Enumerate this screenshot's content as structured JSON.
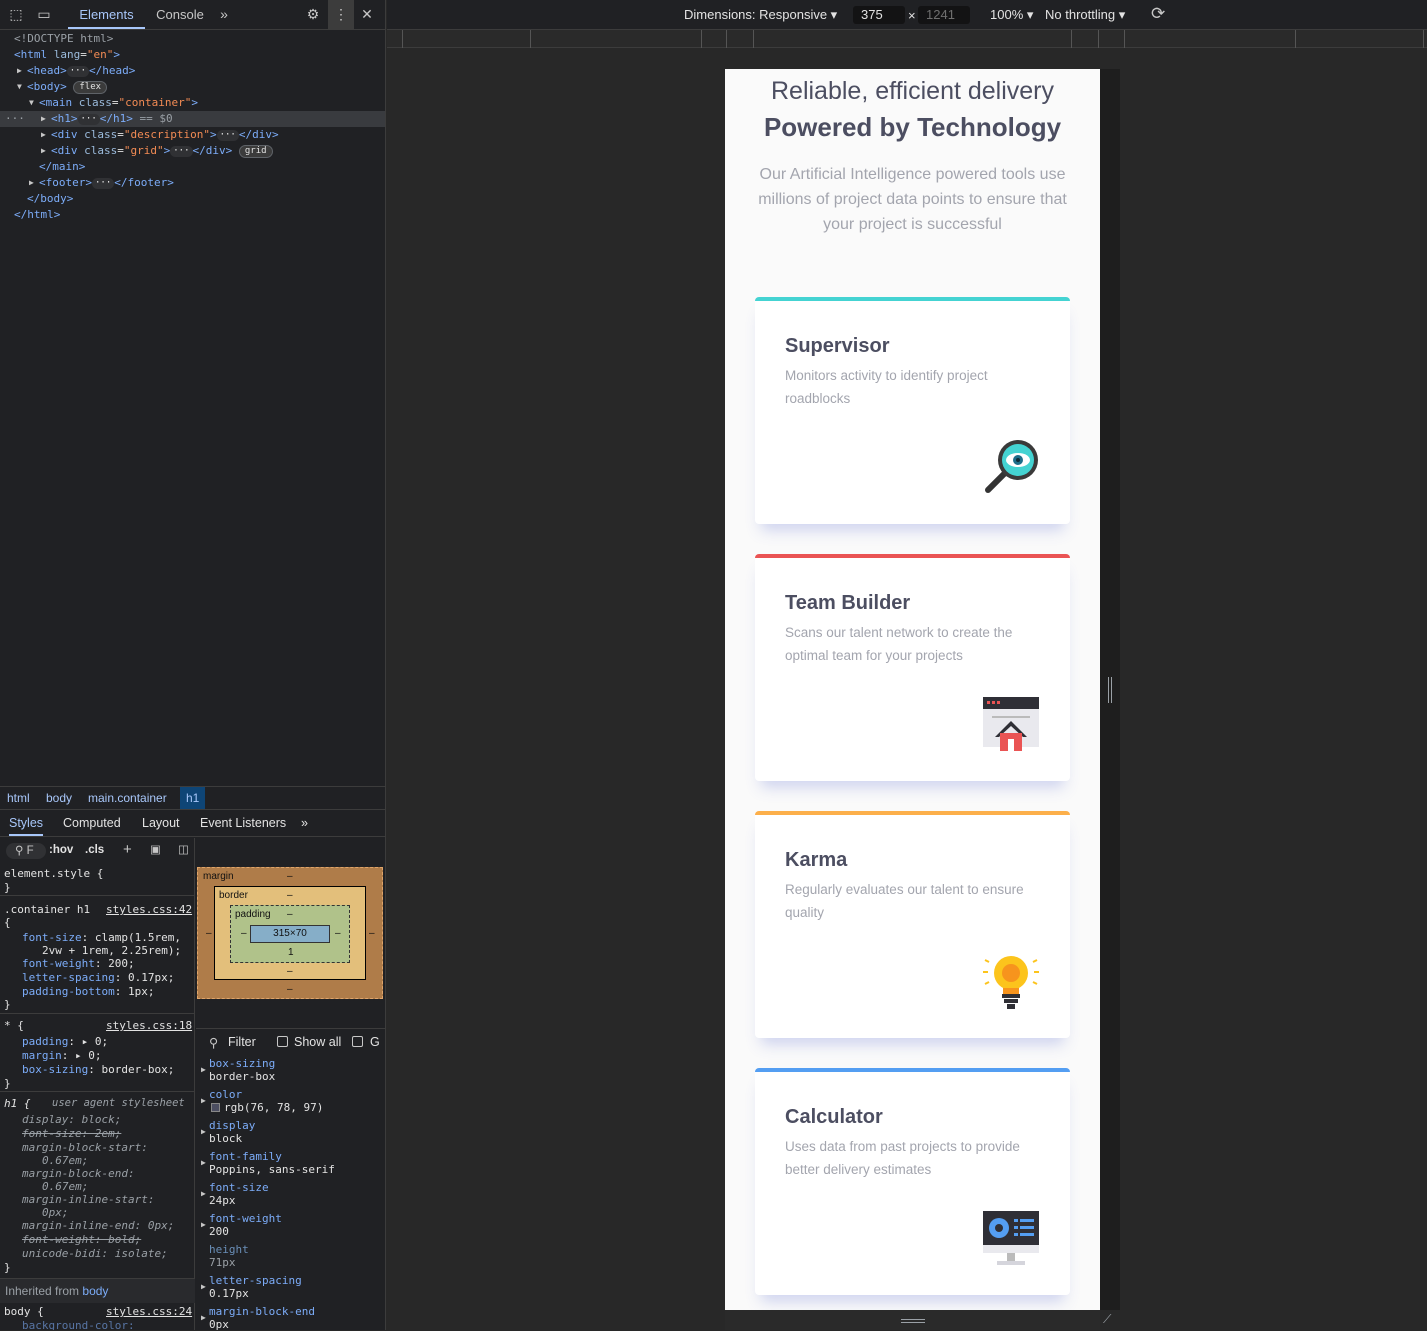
{
  "devtools": {
    "tabs": {
      "elements": "Elements",
      "console": "Console",
      "more": "»"
    },
    "tree": [
      "<!DOCTYPE html>",
      "<html",
      "lang",
      "\"en\"",
      ">",
      "<head>",
      "</head>",
      "<body>",
      "</body>",
      "<main",
      "class",
      "\"container\"",
      "</main>",
      "<h1>",
      "</h1>",
      "== $0",
      "<div",
      "\"description\"",
      "</div>",
      "\"grid\"",
      "<footer>",
      "</footer>",
      "</html>"
    ],
    "badges": {
      "flex": "flex",
      "grid": "grid",
      "dots": "···"
    },
    "breadcrumbs": [
      "html",
      "body",
      "main.container",
      "h1"
    ],
    "style_tabs": [
      "Styles",
      "Computed",
      "Layout",
      "Event Listeners",
      "»"
    ],
    "filter_toolbar": {
      "hov": ":hov",
      "cls": ".cls",
      "filter_char": "F"
    },
    "rules": {
      "element_style": "element.style {",
      "close": "}",
      "container_h1": ".container h1",
      "container_src": "styles.css:42",
      "fs_name": "font-size",
      "fs_val": "clamp(1.5rem,",
      "fs_val2": "2vw + 1rem, 2.25rem);",
      "fw_name": "font-weight",
      "fw_val": "200;",
      "ls_name": "letter-spacing",
      "ls_val": "0.17px;",
      "pb_name": "padding-bottom",
      "pb_val": "1px;",
      "star": "* {",
      "star_src": "styles.css:18",
      "pad_name": "padding",
      "pad_val": "0;",
      "mar_name": "margin",
      "mar_val": "0;",
      "bs_name": "box-sizing",
      "bs_val": "border-box;",
      "h1_sel": "h1 {",
      "ua_label": "user agent stylesheet",
      "ua_display": "display: block;",
      "ua_fs": "font-size: 2em;",
      "ua_mbs": "margin-block-start:",
      "ua_mbs_v": "0.67em;",
      "ua_mbe": "margin-block-end:",
      "ua_mbe_v": "0.67em;",
      "ua_mis": "margin-inline-start:",
      "ua_mis_v": "0px;",
      "ua_mie": "margin-inline-end: 0px;",
      "ua_fw": "font-weight: bold;",
      "ua_ub": "unicode-bidi: isolate;",
      "inherited": "Inherited from",
      "inherited_el": "body",
      "body_sel": "body {",
      "body_src": "styles.css:24",
      "body_prop": "background-color:"
    },
    "box_model": {
      "margin": "margin",
      "border": "border",
      "padding": "padding",
      "content": "315×70",
      "dash": "–",
      "padding_bottom": "1"
    },
    "computed": {
      "filter": "Filter",
      "show_all": "Show all",
      "group": "G",
      "props": [
        {
          "name": "box-sizing",
          "value": "border-box"
        },
        {
          "name": "color",
          "value": "rgb(76, 78, 97)"
        },
        {
          "name": "display",
          "value": "block"
        },
        {
          "name": "font-family",
          "value": "Poppins, sans-serif"
        },
        {
          "name": "font-size",
          "value": "24px"
        },
        {
          "name": "font-weight",
          "value": "200"
        },
        {
          "name": "height",
          "value": "71px"
        },
        {
          "name": "letter-spacing",
          "value": "0.17px"
        },
        {
          "name": "margin-block-end",
          "value": "0px"
        }
      ]
    }
  },
  "device_toolbar": {
    "dimensions": "Dimensions: Responsive ▾",
    "width": "375",
    "times": "×",
    "height": "1241",
    "zoom": "100% ▾",
    "throttle": "No throttling ▾"
  },
  "page": {
    "title_light": "Reliable, efficient delivery",
    "title_bold": "Powered by Technology",
    "description": "Our Artificial Intelligence powered tools use millions of project data points to ensure that your project is successful",
    "cards": [
      {
        "title": "Supervisor",
        "text": "Monitors activity to identify project roadblocks",
        "accent": "#44d3d2",
        "icon": "supervisor-icon"
      },
      {
        "title": "Team Builder",
        "text": "Scans our talent network to create the optimal team for your projects",
        "accent": "#ea5454",
        "icon": "team-builder-icon"
      },
      {
        "title": "Karma",
        "text": "Regularly evaluates our talent to ensure quality",
        "accent": "#fcaf4a",
        "icon": "karma-icon"
      },
      {
        "title": "Calculator",
        "text": "Uses data from past projects to provide better delivery estimates",
        "accent": "#549ef2",
        "icon": "calculator-icon"
      }
    ]
  }
}
